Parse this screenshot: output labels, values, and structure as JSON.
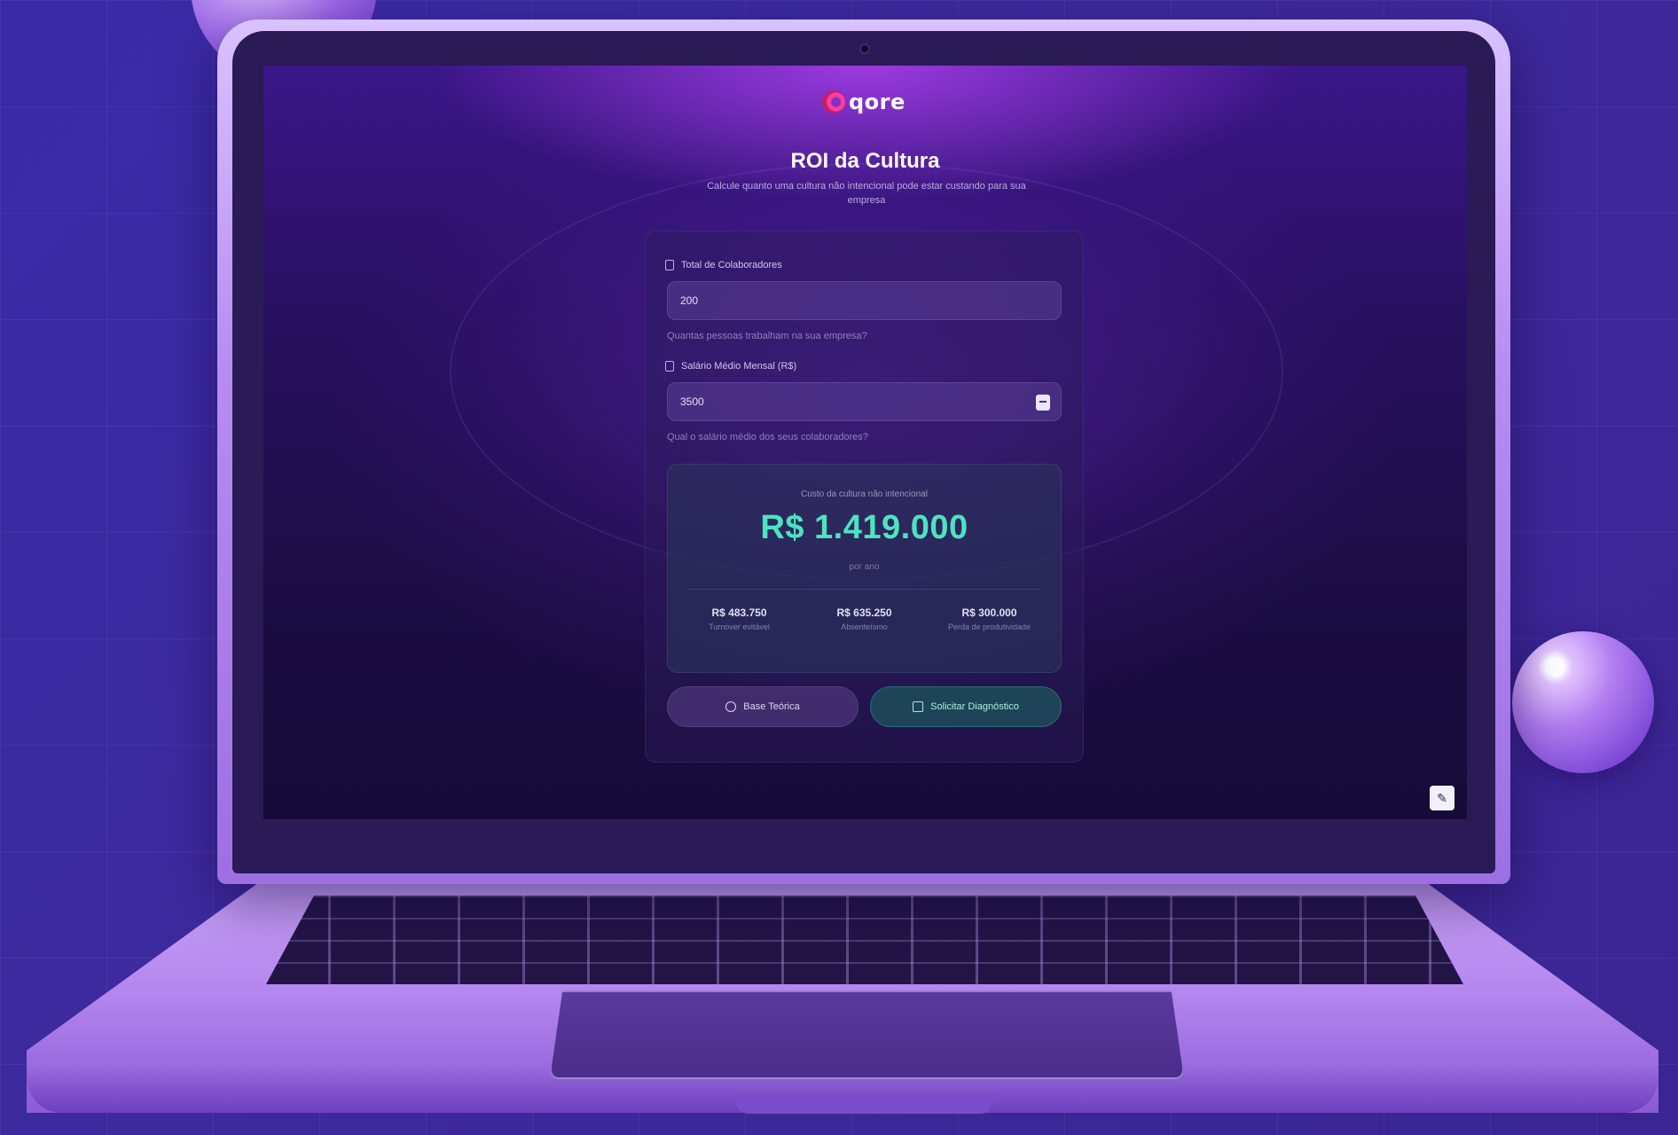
{
  "app": {
    "logo_text": "qore",
    "title": "ROI da Cultura",
    "subtitle": "Calcule quanto uma cultura não intencional pode estar custando para sua empresa"
  },
  "form": {
    "employees": {
      "label": "Total de Colaboradores",
      "value": "200",
      "help": "Quantas pessoas trabalham na sua empresa?"
    },
    "salary": {
      "label": "Salário Médio Mensal (R$)",
      "value": "3500",
      "help": "Qual o salário médio dos seus colaboradores?"
    }
  },
  "result": {
    "caption": "Custo da cultura não intencional",
    "value": "R$ 1.419.000",
    "period": "por ano",
    "breakdown": [
      {
        "value": "R$ 483.750",
        "label": "Turnover evitável"
      },
      {
        "value": "R$ 635.250",
        "label": "Absenteísmo"
      },
      {
        "value": "R$ 300.000",
        "label": "Perda de produtividade"
      }
    ]
  },
  "actions": {
    "secondary_label": "Base Teórica",
    "primary_label": "Solicitar Diagnóstico"
  },
  "icons": {
    "edit": "pencil-icon"
  },
  "colors": {
    "accent": "#4de3c1",
    "brand": "#ff3d9a",
    "background": "#3b2aa8"
  }
}
